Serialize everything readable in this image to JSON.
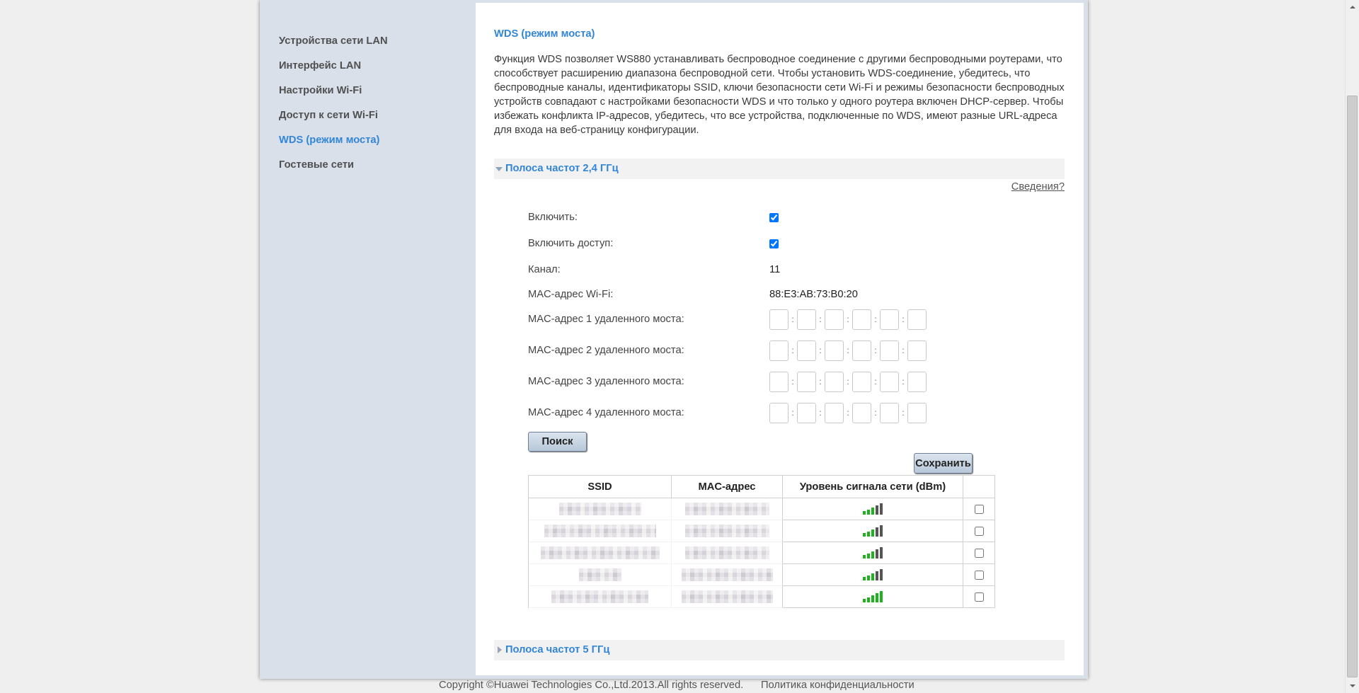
{
  "colors": {
    "accent": "#3386d6",
    "sidebar_bg": "#d9e0ea",
    "signal_on": "#1db31d",
    "signal_off": "#555555"
  },
  "sidebar": {
    "items": [
      {
        "label": "Устройства сети LAN",
        "active": false
      },
      {
        "label": "Интерфейс LAN",
        "active": false
      },
      {
        "label": "Настройки Wi-Fi",
        "active": false
      },
      {
        "label": "Доступ к сети Wi-Fi",
        "active": false
      },
      {
        "label": "WDS (режим моста)",
        "active": true
      },
      {
        "label": "Гостевые сети",
        "active": false
      }
    ]
  },
  "content": {
    "title": "WDS (режим моста)",
    "description": "Функция WDS позволяет WS880 устанавливать беспроводное соединение с другими беспроводными роутерами, что способствует расширению диапазона беспроводной сети. Чтобы установить WDS-соединение, убедитесь, что беспроводные каналы, идентификаторы SSID, ключи безопасности сети Wi-Fi и режимы безопасности беспроводных устройств совпадают с настройками безопасности WDS и что только у одного роутера включен DHCP-сервер. Чтобы избежать конфликта IP-адресов, убедитесь, что все устройства, подключенные по WDS, имеют разные URL-адреса для входа на веб-страницу конфигурации.",
    "band_24": {
      "label": "Полоса частот 2,4 ГГц",
      "expanded": true,
      "help_link": "Сведения?",
      "enable": {
        "label": "Включить:",
        "checked": true
      },
      "enable_access": {
        "label": "Включить доступ:",
        "checked": true
      },
      "channel": {
        "label": "Канал:",
        "value": "11"
      },
      "wifi_mac": {
        "label": "MAC-адрес Wi-Fi:",
        "value": "88:E3:AB:73:B0:20"
      },
      "mac_separator": ":",
      "remote_bridges": [
        {
          "label": "MAC-адрес 1 удаленного моста:",
          "octets": [
            "",
            "",
            "",
            "",
            "",
            ""
          ]
        },
        {
          "label": "MAC-адрес 2 удаленного моста:",
          "octets": [
            "",
            "",
            "",
            "",
            "",
            ""
          ]
        },
        {
          "label": "MAC-адрес 3 удаленного моста:",
          "octets": [
            "",
            "",
            "",
            "",
            "",
            ""
          ]
        },
        {
          "label": "MAC-адрес 4 удаленного моста:",
          "octets": [
            "",
            "",
            "",
            "",
            "",
            ""
          ]
        }
      ],
      "search_button": "Поиск",
      "save_button": "Сохранить",
      "scan_table": {
        "columns": [
          "SSID",
          "MAC-адрес",
          "Уровень сигнала сети (dBm)",
          ""
        ],
        "rows": [
          {
            "ssid_obscured": true,
            "mac_obscured": true,
            "signal_level": 3,
            "signal_max": 5,
            "selected": false
          },
          {
            "ssid_obscured": true,
            "mac_obscured": true,
            "signal_level": 3,
            "signal_max": 5,
            "selected": false
          },
          {
            "ssid_obscured": true,
            "mac_obscured": true,
            "signal_level": 3,
            "signal_max": 5,
            "selected": false
          },
          {
            "ssid_obscured": true,
            "mac_obscured": true,
            "signal_level": 3,
            "signal_max": 5,
            "selected": false
          },
          {
            "ssid_obscured": true,
            "mac_obscured": true,
            "signal_level": 5,
            "signal_max": 5,
            "selected": false
          }
        ]
      }
    },
    "band_5": {
      "label": "Полоса частот 5 ГГц",
      "expanded": false
    }
  },
  "footer": {
    "copyright": "Copyright ©Huawei Technologies Co.,Ltd.2013.All rights reserved.",
    "privacy_link": "Политика конфиденциальности"
  }
}
